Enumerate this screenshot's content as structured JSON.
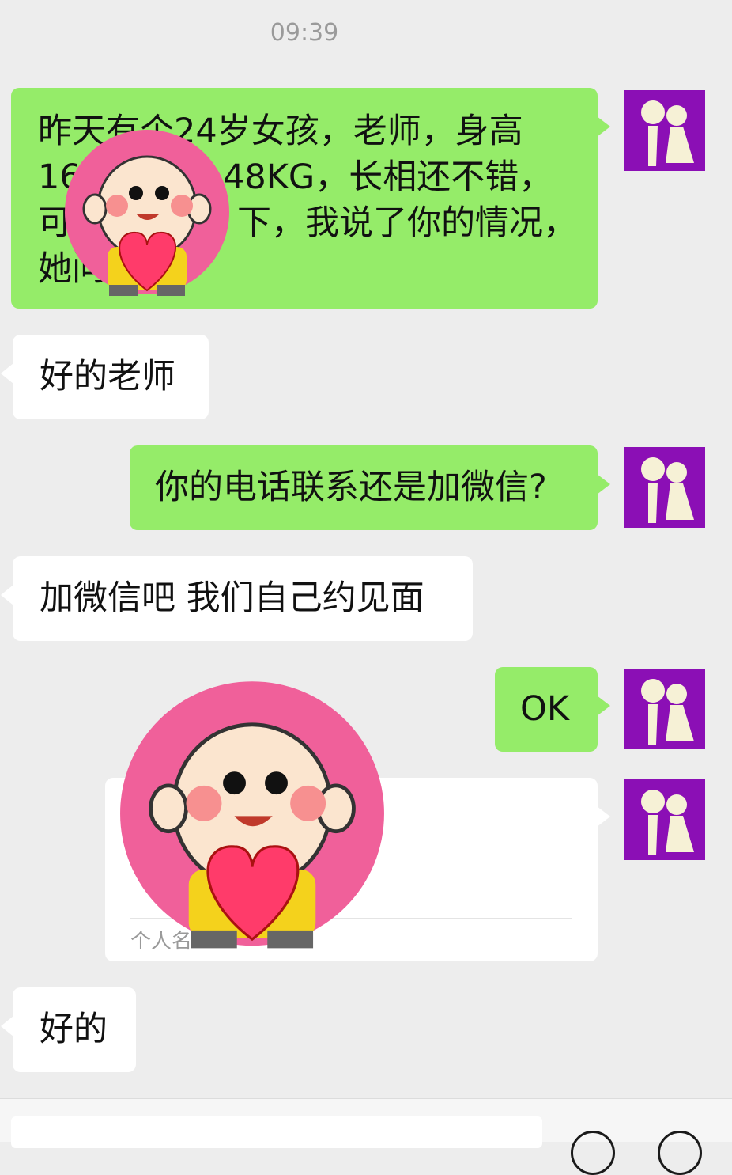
{
  "timestamp": "09:39",
  "messages": [
    {
      "from": "me",
      "text": "昨天有个24岁女孩，老师，身高16… 48KG，长相还不错，可… 下，我说了你的情况，她问…"
    },
    {
      "from": "other",
      "text": "好的老师"
    },
    {
      "from": "me",
      "text": "你的电话联系还是加微信?"
    },
    {
      "from": "other",
      "text": "加微信吧 我们自己约见面"
    },
    {
      "from": "me",
      "text": "OK"
    },
    {
      "from": "me",
      "type": "contact-card",
      "card_label": "个人名…"
    },
    {
      "from": "other",
      "text": "好的"
    }
  ],
  "lines": {
    "m1": [
      "昨天有个24岁女孩，老师，身高",
      "16",
      "48KG，长相还不错，",
      "可",
      "下，我说了你的情况，",
      "她问"
    ]
  },
  "colors": {
    "background": "#ededed",
    "outgoing_bubble": "#95ec69",
    "incoming_bubble": "#ffffff",
    "avatar_bg": "#8b0fb5",
    "sticker_pink": "#f0609a"
  },
  "icons": [
    "couple-avatar-icon",
    "cartoon-boy-heart-sticker",
    "voice-icon",
    "emoji-icon",
    "plus-icon"
  ]
}
